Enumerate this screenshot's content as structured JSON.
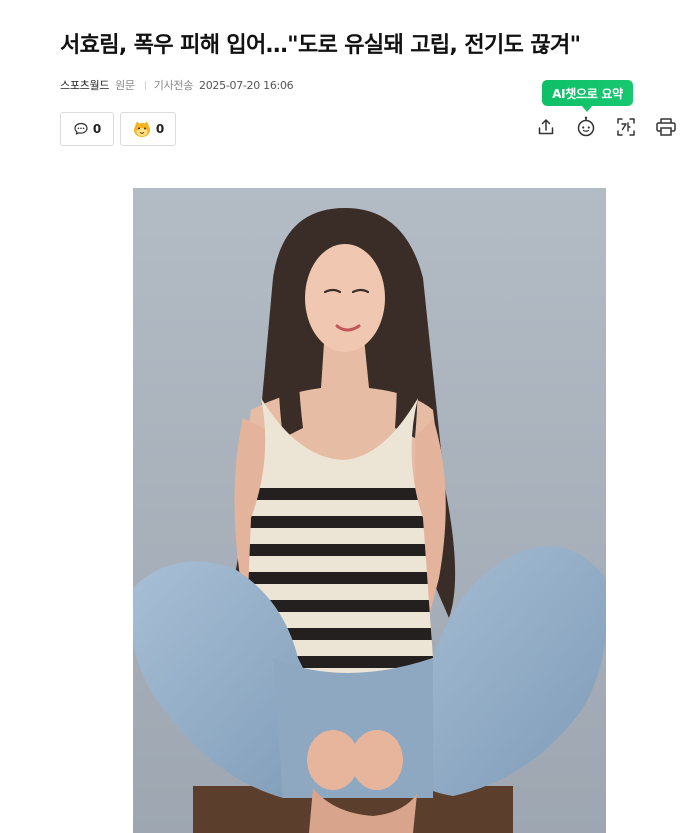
{
  "article": {
    "headline": "서효림, 폭우 피해 입어…\"도로 유실돼 고립, 전기도 끊겨\"",
    "press": "스포츠월드",
    "origin_link": "원문",
    "sent_label": "기사전송",
    "sent_datetime": "2025-07-20 16:06"
  },
  "reactions": {
    "comment_count": "0",
    "emotion_count": "0"
  },
  "tools": {
    "ai_summary_tooltip": "AI챗으로 요약",
    "icons": [
      "share-icon",
      "ai-summary-icon",
      "font-size-icon",
      "print-icon"
    ]
  },
  "colors": {
    "accent_green": "#12c46b",
    "text_primary": "#111111",
    "text_muted": "#888888"
  }
}
